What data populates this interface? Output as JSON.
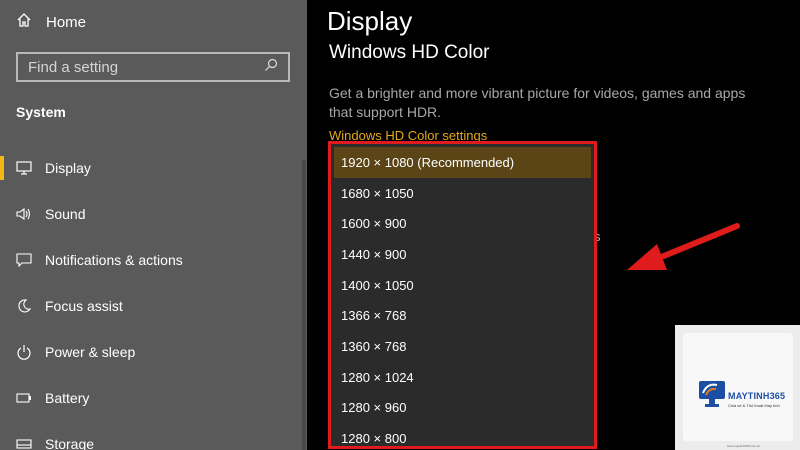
{
  "sidebar": {
    "home_label": "Home",
    "search_placeholder": "Find a setting",
    "section_title": "System",
    "items": [
      {
        "label": "Display",
        "icon": "monitor-icon",
        "active": true
      },
      {
        "label": "Sound",
        "icon": "speaker-icon"
      },
      {
        "label": "Notifications & actions",
        "icon": "message-icon"
      },
      {
        "label": "Focus assist",
        "icon": "moon-icon"
      },
      {
        "label": "Power & sleep",
        "icon": "power-icon"
      },
      {
        "label": "Battery",
        "icon": "battery-icon"
      },
      {
        "label": "Storage",
        "icon": "storage-icon"
      }
    ]
  },
  "main": {
    "title": "Display",
    "subhead": "Windows HD Color",
    "description": "Get a brighter and more vibrant picture for videos, games and apps that support HDR.",
    "link": "Windows HD Color settings",
    "stray_glyph": "s"
  },
  "resolution_dropdown": {
    "options": [
      "1920 × 1080 (Recommended)",
      "1680 × 1050",
      "1600 × 900",
      "1440 × 900",
      "1400 × 1050",
      "1366 × 768",
      "1360 × 768",
      "1280 × 1024",
      "1280 × 960",
      "1280 × 800"
    ],
    "selected_index": 0
  },
  "watermark": {
    "brand": "MAYTINH365",
    "tagline": "Chia sẻ & Thủ thuật Máy tính",
    "footer": "www.maytinh365.com.vn"
  },
  "colors": {
    "accent": "#f5b514",
    "link": "#e4a91a",
    "annotation_red": "#e01b1b",
    "sidebar_bg": "#5a5a5a",
    "selected_option_bg": "#5b4517"
  }
}
